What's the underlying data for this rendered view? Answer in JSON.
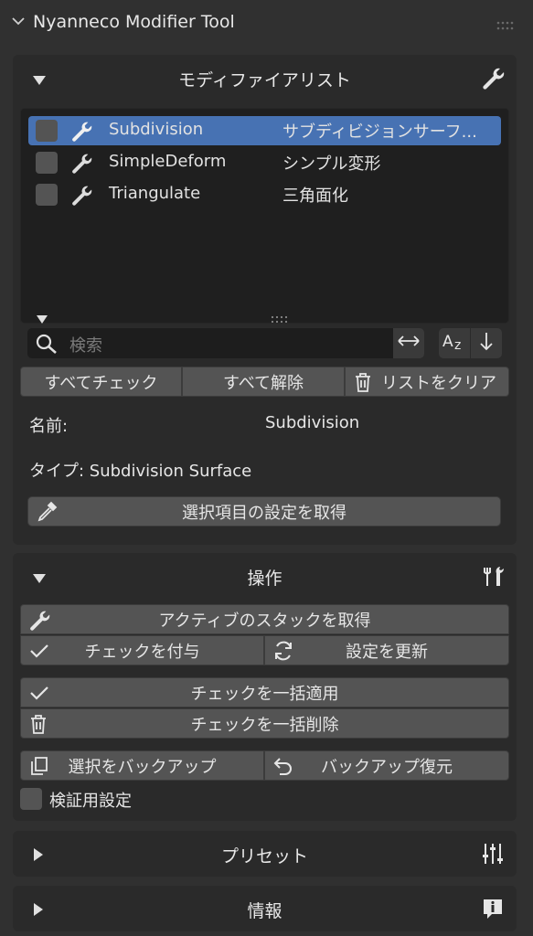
{
  "header": {
    "title": "Nyanneco Modifier Tool"
  },
  "modifier_panel": {
    "title": "モディファイアリスト",
    "items": [
      {
        "name": "Subdivision",
        "desc": "サブディビジョンサーフ...",
        "checked": false,
        "selected": true
      },
      {
        "name": "SimpleDeform",
        "desc": "シンプル変形",
        "checked": false,
        "selected": false
      },
      {
        "name": "Triangulate",
        "desc": "三角面化",
        "checked": false,
        "selected": false
      }
    ],
    "search_placeholder": "検索",
    "check_all": "すべてチェック",
    "uncheck_all": "すべて解除",
    "clear_list": "リストをクリア",
    "name_label": "名前:",
    "name_value": "Subdivision",
    "type_text": "タイプ: Subdivision Surface",
    "get_settings": "選択項目の設定を取得"
  },
  "ops_panel": {
    "title": "操作",
    "get_stack": "アクティブのスタックを取得",
    "apply_check": "チェックを付与",
    "update_settings": "設定を更新",
    "apply_all": "チェックを一括適用",
    "delete_all": "チェックを一括削除",
    "backup": "選択をバックアップ",
    "restore": "バックアップ復元",
    "verify_label": "検証用設定"
  },
  "preset_panel": {
    "title": "プリセット"
  },
  "info_panel": {
    "title": "情報"
  },
  "colors": {
    "selected": "#4772b3",
    "panel": "#2a2a2a",
    "button": "#545454"
  }
}
